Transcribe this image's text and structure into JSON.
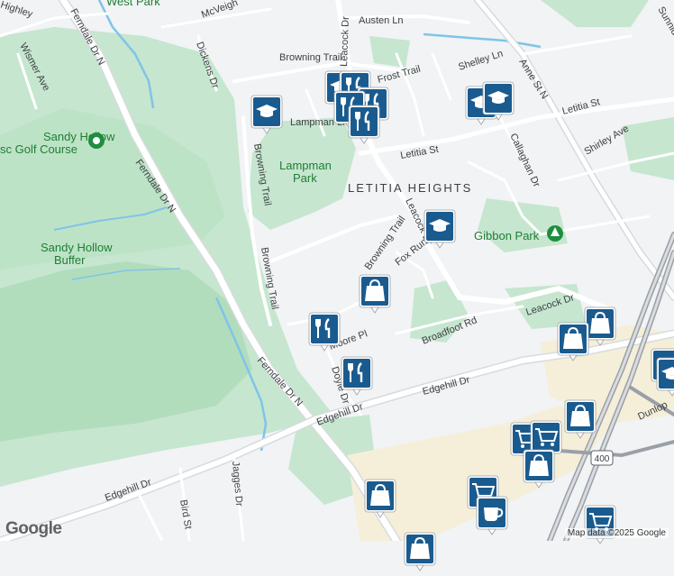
{
  "map": {
    "attribution": "Map data ©2025 Google",
    "logo": "Google",
    "area_label": "LETITIA HEIGHTS",
    "parks": [
      {
        "name": "West Park"
      },
      {
        "name": "Sandy Hollow Golf Course (partial)",
        "display_line1": "Sandy Hollow",
        "display_line2": "sc Golf Course"
      },
      {
        "name": "Lampman Park",
        "display_line1": "Lampman",
        "display_line2": "Park"
      },
      {
        "name": "Sandy Hollow Buffer",
        "display_line1": "Sandy Hollow",
        "display_line2": "Buffer"
      },
      {
        "name": "Gibbon Park"
      }
    ],
    "roads": [
      "Ferndale Dr N",
      "Wismer Ave",
      "McVeigh",
      "Dickens Dr",
      "Browning Trail",
      "Leacock Dr",
      "Austen Ln",
      "Shelley Ln",
      "Anne St N",
      "Sunnidale",
      "Frost Trail",
      "Lampman Ln",
      "Letitia St",
      "Callaghan Dr",
      "Shirley Ave",
      "Fox Run Dr",
      "Broadfoot Rd",
      "Moore Pl",
      "Doyle Dr",
      "Edgehill Dr",
      "Dunlop",
      "Jagges Dr",
      "Bird St",
      "Highley"
    ],
    "highway_shield": "400",
    "marker_types": [
      "school-icon",
      "restaurant-icon",
      "shopping-bag-icon",
      "shopping-cart-icon",
      "coffee-icon"
    ],
    "colors": {
      "marker": "#1a5b8f",
      "park": "#a8dab5",
      "park_text": "#1e7e34",
      "road": "#ffffff",
      "highway": "#9aa0a6",
      "commercial": "#f5efd9"
    }
  }
}
